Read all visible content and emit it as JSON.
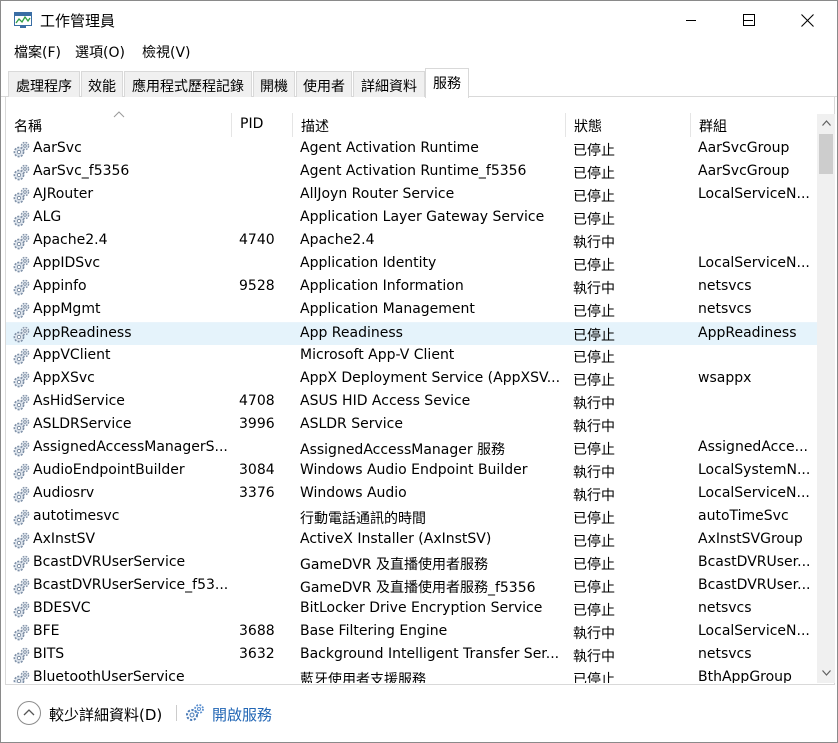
{
  "window": {
    "title": "工作管理員"
  },
  "menu": [
    {
      "label": "檔案(F)"
    },
    {
      "label": "選項(O)"
    },
    {
      "label": "檢視(V)"
    }
  ],
  "tabs": [
    {
      "label": "處理程序"
    },
    {
      "label": "效能"
    },
    {
      "label": "應用程式歷程記錄"
    },
    {
      "label": "開機"
    },
    {
      "label": "使用者"
    },
    {
      "label": "詳細資料"
    },
    {
      "label": "服務",
      "active": true
    }
  ],
  "columns": {
    "name": "名稱",
    "pid": "PID",
    "desc": "描述",
    "status": "狀態",
    "group": "群組"
  },
  "services": [
    {
      "name": "AarSvc",
      "pid": "",
      "desc": "Agent Activation Runtime",
      "status": "已停止",
      "group": "AarSvcGroup"
    },
    {
      "name": "AarSvc_f5356",
      "pid": "",
      "desc": "Agent Activation Runtime_f5356",
      "status": "已停止",
      "group": "AarSvcGroup"
    },
    {
      "name": "AJRouter",
      "pid": "",
      "desc": "AllJoyn Router Service",
      "status": "已停止",
      "group": "LocalServiceN..."
    },
    {
      "name": "ALG",
      "pid": "",
      "desc": "Application Layer Gateway Service",
      "status": "已停止",
      "group": ""
    },
    {
      "name": "Apache2.4",
      "pid": "4740",
      "desc": "Apache2.4",
      "status": "執行中",
      "group": ""
    },
    {
      "name": "AppIDSvc",
      "pid": "",
      "desc": "Application Identity",
      "status": "已停止",
      "group": "LocalServiceN..."
    },
    {
      "name": "Appinfo",
      "pid": "9528",
      "desc": "Application Information",
      "status": "執行中",
      "group": "netsvcs"
    },
    {
      "name": "AppMgmt",
      "pid": "",
      "desc": "Application Management",
      "status": "已停止",
      "group": "netsvcs"
    },
    {
      "name": "AppReadiness",
      "pid": "",
      "desc": "App Readiness",
      "status": "已停止",
      "group": "AppReadiness",
      "selected": true
    },
    {
      "name": "AppVClient",
      "pid": "",
      "desc": "Microsoft App-V Client",
      "status": "已停止",
      "group": ""
    },
    {
      "name": "AppXSvc",
      "pid": "",
      "desc": "AppX Deployment Service (AppXSV...",
      "status": "已停止",
      "group": "wsappx"
    },
    {
      "name": "AsHidService",
      "pid": "4708",
      "desc": "ASUS HID Access Sevice",
      "status": "執行中",
      "group": ""
    },
    {
      "name": "ASLDRService",
      "pid": "3996",
      "desc": "ASLDR Service",
      "status": "執行中",
      "group": ""
    },
    {
      "name": "AssignedAccessManagerS...",
      "pid": "",
      "desc": "AssignedAccessManager 服務",
      "status": "已停止",
      "group": "AssignedAcce..."
    },
    {
      "name": "AudioEndpointBuilder",
      "pid": "3084",
      "desc": "Windows Audio Endpoint Builder",
      "status": "執行中",
      "group": "LocalSystemN..."
    },
    {
      "name": "Audiosrv",
      "pid": "3376",
      "desc": "Windows Audio",
      "status": "執行中",
      "group": "LocalServiceN..."
    },
    {
      "name": "autotimesvc",
      "pid": "",
      "desc": "行動電話通訊的時間",
      "status": "已停止",
      "group": "autoTimeSvc"
    },
    {
      "name": "AxInstSV",
      "pid": "",
      "desc": "ActiveX Installer (AxInstSV)",
      "status": "已停止",
      "group": "AxInstSVGroup"
    },
    {
      "name": "BcastDVRUserService",
      "pid": "",
      "desc": "GameDVR 及直播使用者服務",
      "status": "已停止",
      "group": "BcastDVRUser..."
    },
    {
      "name": "BcastDVRUserService_f53...",
      "pid": "",
      "desc": "GameDVR 及直播使用者服務_f5356",
      "status": "已停止",
      "group": "BcastDVRUser..."
    },
    {
      "name": "BDESVC",
      "pid": "",
      "desc": "BitLocker Drive Encryption Service",
      "status": "已停止",
      "group": "netsvcs"
    },
    {
      "name": "BFE",
      "pid": "3688",
      "desc": "Base Filtering Engine",
      "status": "執行中",
      "group": "LocalServiceN..."
    },
    {
      "name": "BITS",
      "pid": "3632",
      "desc": "Background Intelligent Transfer Ser...",
      "status": "執行中",
      "group": "netsvcs"
    },
    {
      "name": "BluetoothUserService",
      "pid": "",
      "desc": "藍牙使用者支援服務",
      "status": "已停止",
      "group": "BthAppGroup"
    }
  ],
  "footer": {
    "fewer_details": "較少詳細資料(D)",
    "open_services": "開啟服務"
  },
  "icons": {
    "app": "task-manager-icon",
    "service": "gear-icon",
    "minimize": "minimize-icon",
    "maximize": "maximize-icon",
    "close": "close-icon",
    "sort": "sort-ascending-icon",
    "fewer": "chevron-up-icon",
    "open": "services-gear-icon"
  },
  "colors": {
    "selected_row": "#e5f3fb",
    "link": "#2266b5"
  }
}
